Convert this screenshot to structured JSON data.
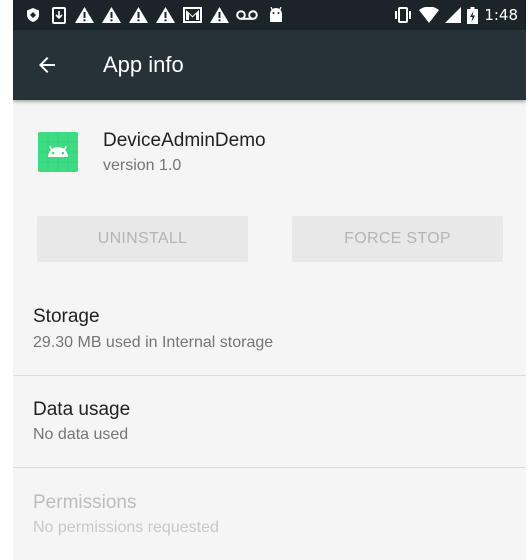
{
  "status_bar": {
    "time": "1:48",
    "icons": [
      "shield-icon",
      "download-icon",
      "warning-icon",
      "warning-icon",
      "warning-icon",
      "warning-icon",
      "gmail-icon",
      "warning-icon",
      "voicemail-icon",
      "android-icon",
      "vibrate-icon",
      "wifi-icon",
      "signal-icon",
      "battery-charging-icon"
    ]
  },
  "app_bar": {
    "title": "App info",
    "back_icon": "arrow-back-icon"
  },
  "app": {
    "name": "DeviceAdminDemo",
    "version": "version 1.0",
    "icon": "android-app-icon"
  },
  "buttons": {
    "uninstall": "UNINSTALL",
    "force_stop": "FORCE STOP"
  },
  "prefs": {
    "storage": {
      "title": "Storage",
      "summary": "29.30 MB used in Internal storage"
    },
    "data_usage": {
      "title": "Data usage",
      "summary": "No data used"
    },
    "permissions": {
      "title": "Permissions",
      "summary": "No permissions requested"
    }
  },
  "colors": {
    "app_bar": "#263238",
    "status_bar": "#1b2529",
    "background": "#f5f5f5",
    "app_icon": "#3ddc84"
  }
}
